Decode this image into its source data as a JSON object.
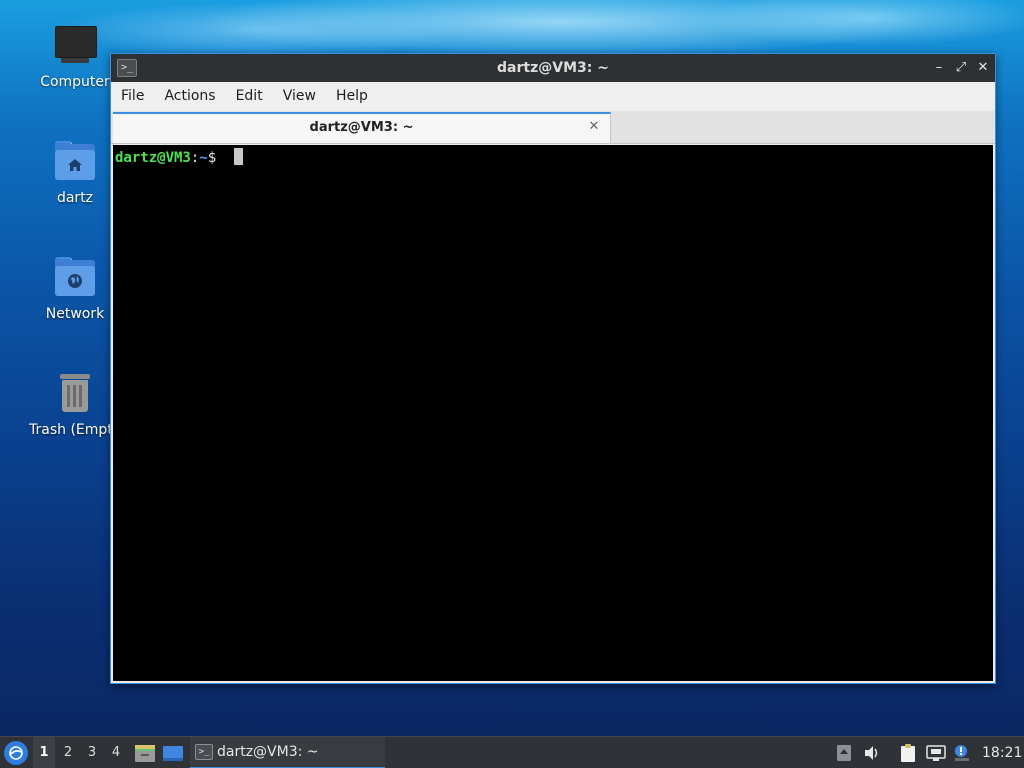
{
  "desktop": {
    "icons": [
      {
        "label": "Computer",
        "icon": "computer-icon"
      },
      {
        "label": "dartz",
        "icon": "home-folder-icon"
      },
      {
        "label": "Network",
        "icon": "network-folder-icon"
      },
      {
        "label": "Trash (Empty)",
        "icon": "trash-icon"
      }
    ]
  },
  "window": {
    "title": "dartz@VM3: ~",
    "controls": {
      "minimize": "–",
      "maximize": "⤢",
      "close": "✕"
    },
    "menu": [
      "File",
      "Actions",
      "Edit",
      "View",
      "Help"
    ],
    "tab": {
      "label": "dartz@VM3: ~",
      "close": "✕"
    },
    "terminal": {
      "user_host": "dartz@VM3",
      "separator": ":",
      "path": "~",
      "prompt_symbol": "$ "
    }
  },
  "taskbar": {
    "workspaces": [
      "1",
      "2",
      "3",
      "4"
    ],
    "active_workspace": "1",
    "task": {
      "label": "dartz@VM3: ~",
      "icon": "terminal-icon"
    },
    "clock": "18:21"
  },
  "colors": {
    "prompt_user": "#4ee34e",
    "prompt_path": "#5c9df5",
    "accent": "#3c8fe0"
  }
}
